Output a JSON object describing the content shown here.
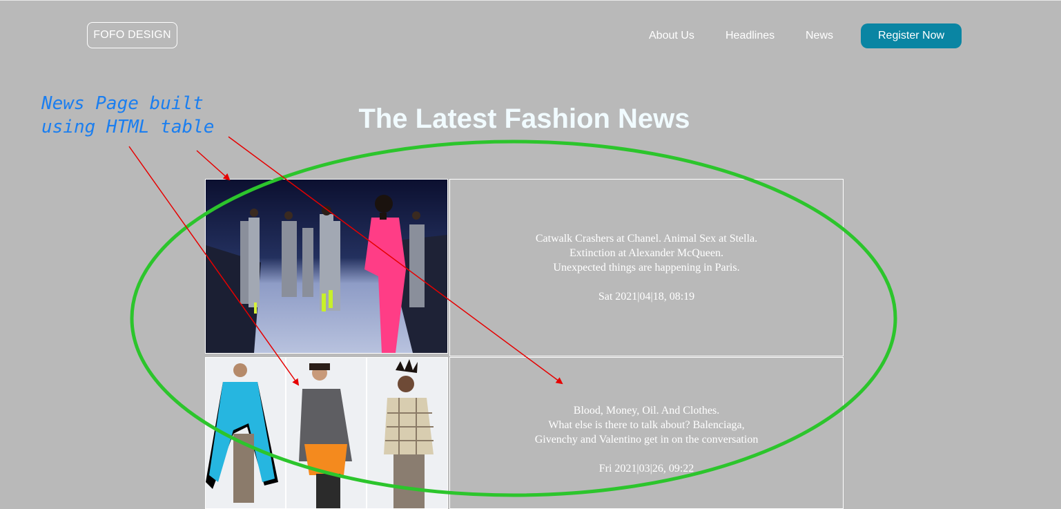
{
  "header": {
    "logo": "FOFO DESIGN",
    "nav": [
      "About Us",
      "Headlines",
      "News"
    ],
    "cta": "Register Now"
  },
  "page_title": "The Latest Fashion News",
  "annotation": {
    "line1": "News Page built",
    "line2": "using HTML table"
  },
  "news": [
    {
      "lines": [
        "Catwalk Crashers at Chanel. Animal Sex at Stella.",
        "Extinction at Alexander McQueen.",
        "Unexpected things are happening in Paris."
      ],
      "date": "Sat 2021|04|18, 08:19"
    },
    {
      "lines": [
        "Blood, Money, Oil. And Clothes.",
        "What else is there to talk about? Balenciaga,",
        "Givenchy and Valentino get in on the conversation"
      ],
      "date": "Fri 2021|03|26, 09:22"
    }
  ],
  "colors": {
    "background": "#b9b9b9",
    "cta": "#0a85a3",
    "annotation_text": "#1a7ef0",
    "annotation_ellipse": "#2cc52c",
    "annotation_arrows": "#e60000"
  }
}
